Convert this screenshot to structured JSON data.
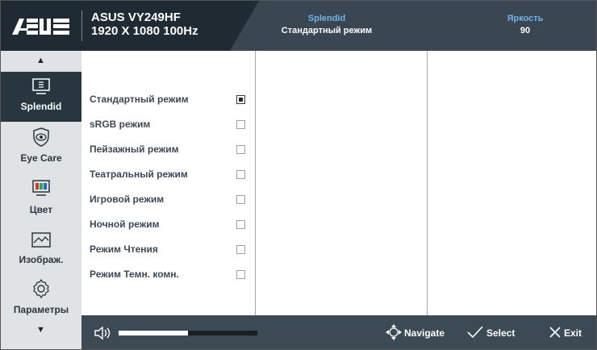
{
  "header": {
    "brand": "ASUS",
    "model_line1": "ASUS VY249HF",
    "model_line2": "1920 X 1080 100Hz",
    "mode_label": "Splendid",
    "mode_value": "Стандартный режим",
    "brightness_label": "Яркость",
    "brightness_value": "90"
  },
  "sidebar": {
    "items": [
      {
        "label": "Splendid",
        "icon": "splendid-icon",
        "active": true
      },
      {
        "label": "Eye Care",
        "icon": "eye-care-icon",
        "active": false
      },
      {
        "label": "Цвет",
        "icon": "color-icon",
        "active": false
      },
      {
        "label": "Изображ.",
        "icon": "image-icon",
        "active": false
      },
      {
        "label": "Параметры",
        "icon": "settings-icon",
        "active": false
      }
    ]
  },
  "options": [
    {
      "label": "Стандартный режим",
      "checked": true
    },
    {
      "label": "sRGB режим",
      "checked": false
    },
    {
      "label": "Пейзажный режим",
      "checked": false
    },
    {
      "label": "Театральный режим",
      "checked": false
    },
    {
      "label": "Игровой режим",
      "checked": false
    },
    {
      "label": "Ночной режим",
      "checked": false
    },
    {
      "label": "Режим Чтения",
      "checked": false
    },
    {
      "label": "Режим Темн. комн.",
      "checked": false
    }
  ],
  "footer": {
    "volume_fraction": 0.5,
    "navigate_label": "Navigate",
    "select_label": "Select",
    "exit_label": "Exit"
  },
  "colors": {
    "header_bg": "#1f2a32",
    "accent_blue": "#6fb4e6",
    "sidebar_bg": "#dfe3e6",
    "active_bg": "#283640",
    "footer_bg": "#3c4a56"
  }
}
